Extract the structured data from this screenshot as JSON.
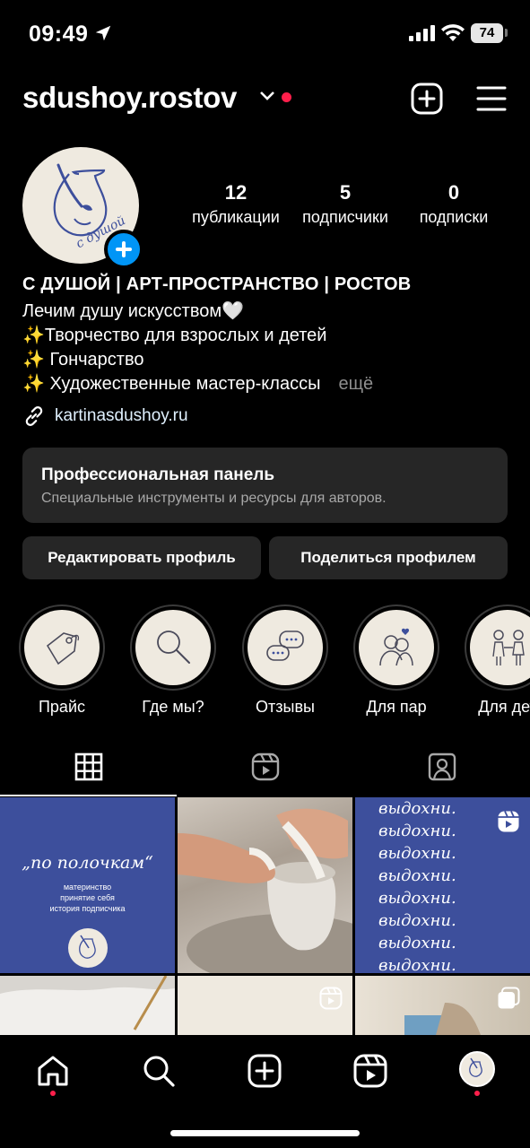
{
  "status_bar": {
    "time": "09:49",
    "battery": "74"
  },
  "header": {
    "username": "sdushoy.rostov"
  },
  "profile": {
    "stats": [
      {
        "value": "12",
        "label": "публикации"
      },
      {
        "value": "5",
        "label": "подписчики"
      },
      {
        "value": "0",
        "label": "подписки"
      }
    ],
    "name": "С ДУШОЙ | АРТ-ПРОСТРАНСТВО | РОСТОВ",
    "bio_lines": [
      "Лечим душу искусством🤍",
      "✨Творчество для взрослых и детей",
      "✨ Гончарство",
      "✨ Художественные мастер-классы"
    ],
    "more": "ещё",
    "link": "kartinasdushoy.ru"
  },
  "pro_panel": {
    "title": "Профессиональная панель",
    "subtitle": "Специальные инструменты и ресурсы для авторов."
  },
  "buttons": {
    "edit": "Редактировать профиль",
    "share": "Поделиться профилем"
  },
  "highlights": [
    {
      "label": "Прайс",
      "icon": "price-tag-icon"
    },
    {
      "label": "Где мы?",
      "icon": "magnifier-icon"
    },
    {
      "label": "Отзывы",
      "icon": "chat-bubbles-icon"
    },
    {
      "label": "Для пар",
      "icon": "couple-icon"
    },
    {
      "label": "Для дет",
      "icon": "children-icon"
    }
  ],
  "tabs": [
    {
      "name": "grid",
      "icon": "grid-icon",
      "active": true
    },
    {
      "name": "reels",
      "icon": "reels-icon",
      "active": false
    },
    {
      "name": "tagged",
      "icon": "tagged-icon",
      "active": false
    }
  ],
  "posts": {
    "post1": {
      "title": "„по полочкам“",
      "lines": [
        "материнство",
        "принятие себя",
        "история подписчика"
      ]
    },
    "post3": {
      "words": [
        "выдохни.",
        "выдохни.",
        "выдохни.",
        "выдохни.",
        "выдохни.",
        "выдохни.",
        "выдохни.",
        "выдохни."
      ]
    }
  },
  "colors": {
    "accent": "#0095f6",
    "notification": "#ff1f4b",
    "post_blue": "#3d4f9c",
    "beige": "#efeae0"
  }
}
